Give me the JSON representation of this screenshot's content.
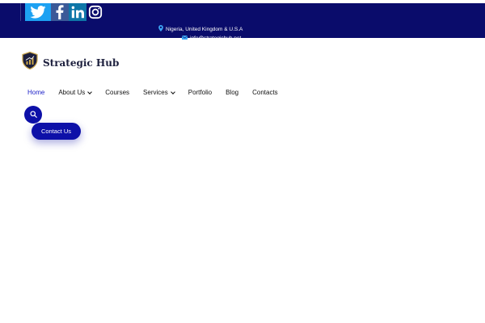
{
  "colors": {
    "topbar_bg": "#0a0c6b",
    "accent": "#0d10a8",
    "active_nav": "#1e22c8"
  },
  "topbar": {
    "social_icons": [
      "twitter-icon",
      "facebook-icon",
      "linkedin-icon",
      "instagram-icon"
    ],
    "location": "Nigeria, United Kingdom & U.S.A",
    "email": "info@strategichub.net"
  },
  "brand": {
    "name": "Strategic Hub",
    "logo_icon": "shield-logo-icon"
  },
  "nav": {
    "items": [
      {
        "label": "Home",
        "active": true,
        "dropdown": false
      },
      {
        "label": "About Us",
        "active": false,
        "dropdown": true
      },
      {
        "label": "Courses",
        "active": false,
        "dropdown": false
      },
      {
        "label": "Services",
        "active": false,
        "dropdown": true
      },
      {
        "label": "Portfolio",
        "active": false,
        "dropdown": false
      },
      {
        "label": "Blog",
        "active": false,
        "dropdown": false
      },
      {
        "label": "Contacts",
        "active": false,
        "dropdown": false
      }
    ]
  },
  "search": {
    "icon": "search-icon"
  },
  "cta": {
    "label": "Contact Us"
  }
}
